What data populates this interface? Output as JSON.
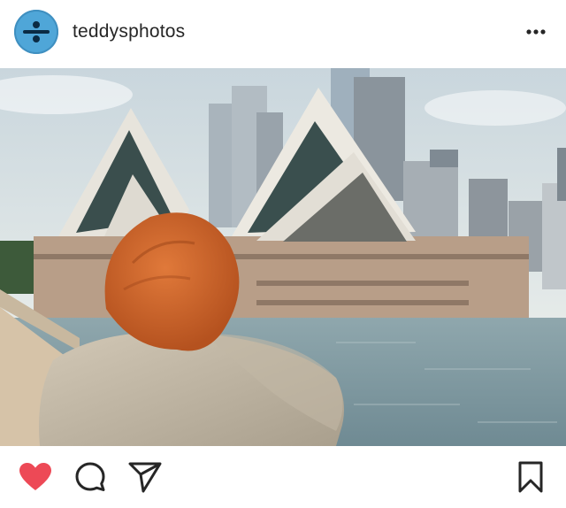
{
  "post": {
    "username": "teddysphotos",
    "avatar_icon": "divide-sign-icon",
    "avatar_color": "#4fa6d8",
    "more_icon": "more-options-icon",
    "photo_subject": "",
    "actions": {
      "like_icon": "heart-filled-icon",
      "like_color": "#ed4956",
      "comment_icon": "comment-icon",
      "share_icon": "direct-share-icon",
      "save_icon": "bookmark-icon"
    }
  }
}
